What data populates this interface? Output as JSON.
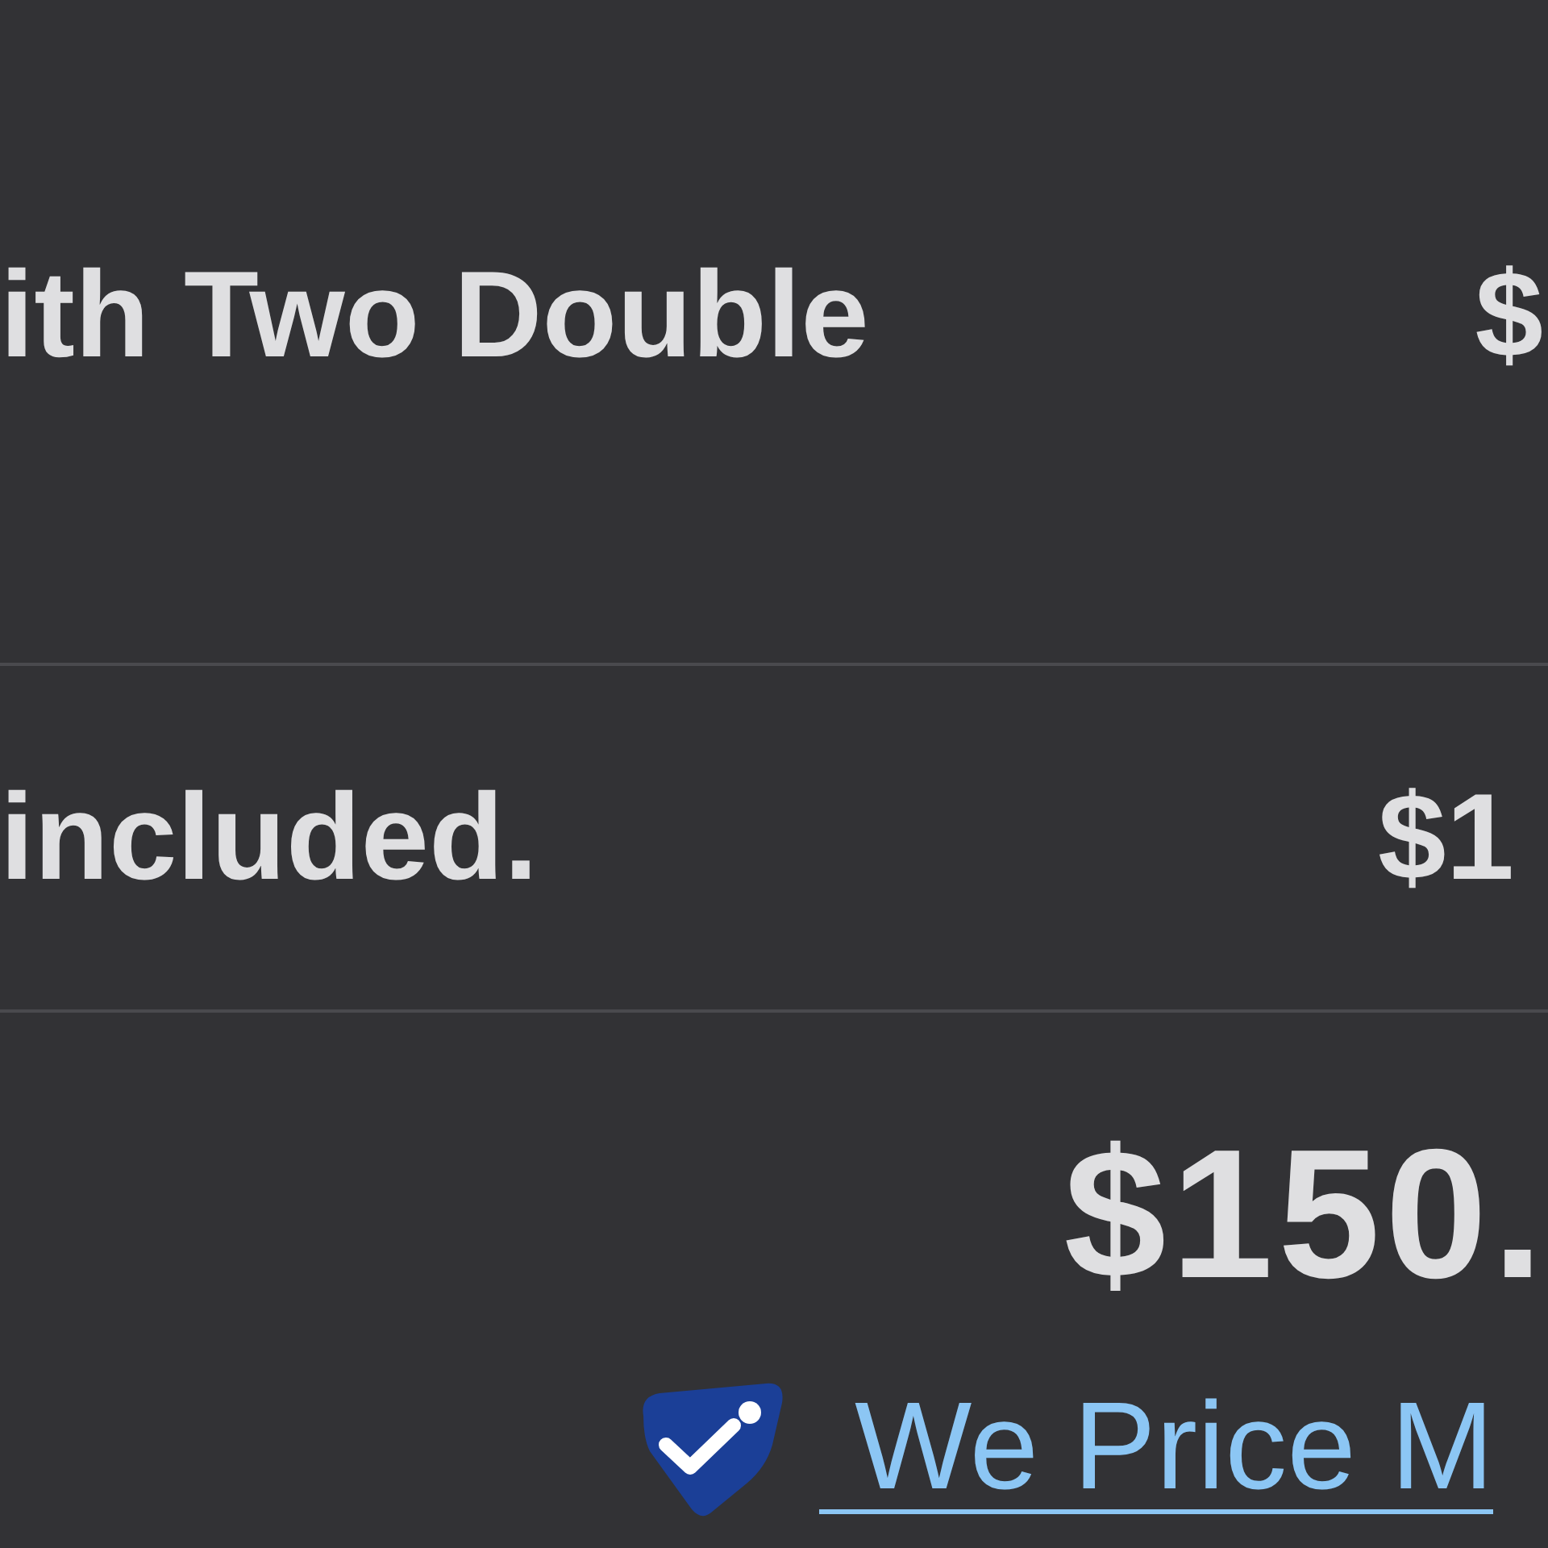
{
  "line_items": [
    {
      "title": "ith Two Double",
      "price": "$"
    },
    {
      "title": "included.",
      "price": "$1"
    }
  ],
  "total": "$150.",
  "price_match": {
    "label": "We Price M"
  }
}
